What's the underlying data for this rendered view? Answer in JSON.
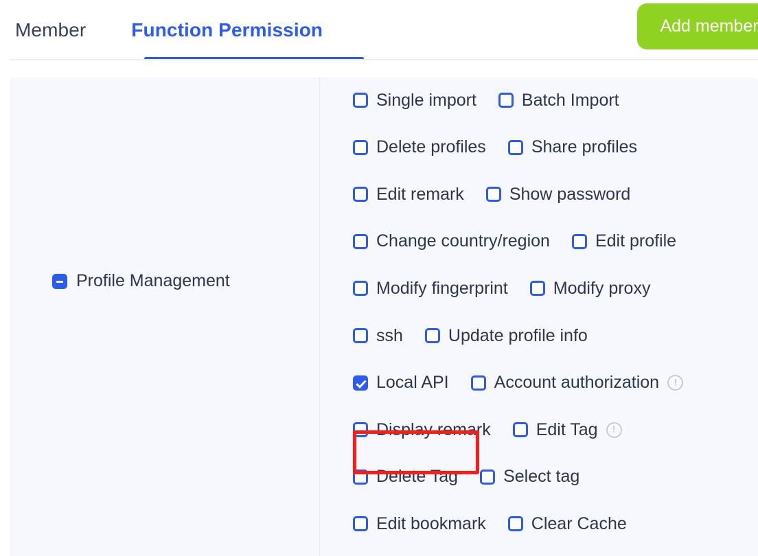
{
  "header": {
    "tabs": [
      {
        "label": "Member",
        "active": false
      },
      {
        "label": "Function Permission",
        "active": true
      }
    ],
    "add_member_label": "Add member",
    "accent_color": "#2b5bf5",
    "button_color": "#8fd221"
  },
  "group": {
    "label": "Profile Management",
    "state": "indeterminate"
  },
  "permissions": {
    "rows": [
      {
        "items": [
          {
            "label": "Single import",
            "checked": false,
            "info": false
          },
          {
            "label": "Batch Import",
            "checked": false,
            "info": false
          }
        ]
      },
      {
        "items": [
          {
            "label": "Delete profiles",
            "checked": false,
            "info": false
          },
          {
            "label": "Share profiles",
            "checked": false,
            "info": false
          }
        ]
      },
      {
        "items": [
          {
            "label": "Edit remark",
            "checked": false,
            "info": false
          },
          {
            "label": "Show password",
            "checked": false,
            "info": false
          }
        ]
      },
      {
        "items": [
          {
            "label": "Change country/region",
            "checked": false,
            "info": false
          },
          {
            "label": "Edit profile",
            "checked": false,
            "info": false
          }
        ]
      },
      {
        "items": [
          {
            "label": "Modify fingerprint",
            "checked": false,
            "info": false
          },
          {
            "label": "Modify proxy",
            "checked": false,
            "info": false
          }
        ]
      },
      {
        "items": [
          {
            "label": "ssh",
            "checked": false,
            "info": false
          },
          {
            "label": "Update profile info",
            "checked": false,
            "info": false
          }
        ]
      },
      {
        "items": [
          {
            "label": "Local API",
            "checked": true,
            "info": false
          },
          {
            "label": "Account authorization",
            "checked": false,
            "info": true
          }
        ]
      },
      {
        "items": [
          {
            "label": "Display remark",
            "checked": false,
            "info": false
          },
          {
            "label": "Edit Tag",
            "checked": false,
            "info": true
          }
        ]
      },
      {
        "items": [
          {
            "label": "Delete Tag",
            "checked": false,
            "info": false
          },
          {
            "label": "Select tag",
            "checked": false,
            "info": false
          }
        ]
      },
      {
        "items": [
          {
            "label": "Edit bookmark",
            "checked": false,
            "info": false
          },
          {
            "label": "Clear Cache",
            "checked": false,
            "info": false
          }
        ]
      }
    ]
  },
  "annotation": {
    "target": "Local API",
    "color": "#fe1c15"
  }
}
